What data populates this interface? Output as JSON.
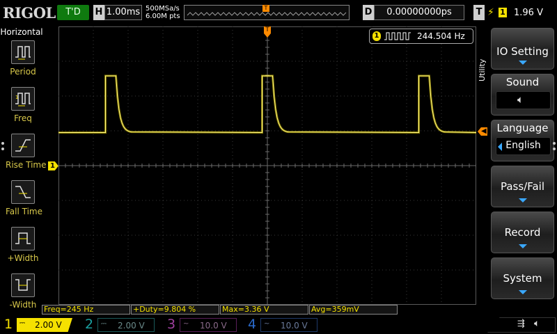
{
  "brand": "RIGOL",
  "trigger_status": "T'D",
  "horizontal": {
    "key": "H",
    "timebase": "1.00ms",
    "sample_rate": "500MSa/s",
    "memory_depth": "6.00M pts"
  },
  "delay": {
    "key": "D",
    "value": "0.00000000ps"
  },
  "trigger": {
    "key": "T",
    "channel": "1",
    "level": "1.96 V"
  },
  "left_menu": {
    "title": "Horizontal",
    "items": [
      {
        "label": "Period",
        "icon": "period-icon"
      },
      {
        "label": "Freq",
        "icon": "freq-icon"
      },
      {
        "label": "Rise Time",
        "icon": "rise-time-icon"
      },
      {
        "label": "Fall Time",
        "icon": "fall-time-icon"
      },
      {
        "label": "+Width",
        "icon": "pos-width-icon"
      },
      {
        "label": "-Width",
        "icon": "neg-width-icon"
      }
    ]
  },
  "freq_counter": {
    "channel": "1",
    "value": "244.504 Hz"
  },
  "measurements": [
    {
      "label": "Freq=245 Hz"
    },
    {
      "label": "+Duty=9.804 %"
    },
    {
      "label": "Max=3.36 V"
    },
    {
      "label": "Avg=359mV"
    }
  ],
  "right_menu": {
    "side_label": "Utility",
    "io_setting": "IO Setting",
    "sound": "Sound",
    "language": "Language",
    "language_value": "English",
    "pass_fail": "Pass/Fail",
    "record": "Record",
    "system": "System"
  },
  "channels": [
    {
      "num": "1",
      "scale": "2.00 V",
      "color": "#f5e100",
      "active": true
    },
    {
      "num": "2",
      "scale": "2.00 V",
      "color": "#1aa0a0",
      "active": false
    },
    {
      "num": "3",
      "scale": "10.0 V",
      "color": "#c040c0",
      "active": false
    },
    {
      "num": "4",
      "scale": "10.0 V",
      "color": "#2060c0",
      "active": false
    }
  ],
  "waveform": {
    "pulses": [
      {
        "start_div": 1.35,
        "end_div": 1.65
      },
      {
        "start_div": 5.85,
        "end_div": 6.15
      },
      {
        "start_div": 10.35,
        "end_div": 10.65
      }
    ],
    "low_level_div": 3.05,
    "high_level_div": 1.42
  },
  "colors": {
    "ch1": "#f5e100",
    "trigger": "#ff8a00",
    "accent": "#3aa8ff"
  }
}
